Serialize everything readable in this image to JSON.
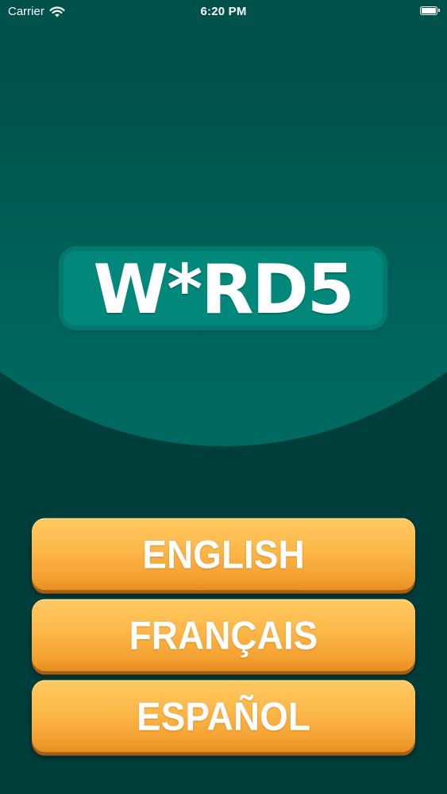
{
  "status_bar": {
    "carrier": "Carrier",
    "time": "6:20 PM",
    "icons": [
      "wifi-icon",
      "battery-icon"
    ]
  },
  "logo": {
    "text": "W*RD5"
  },
  "language_buttons": [
    {
      "label": "ENGLISH"
    },
    {
      "label": "FRANÇAIS"
    },
    {
      "label": "ESPAÑOL"
    }
  ],
  "colors": {
    "background": "#003e3b",
    "hero": "#00524a",
    "logo_tile": "#02877b",
    "button_top": "#ffca62",
    "button_bottom": "#e68f22",
    "text": "#ffffff"
  }
}
